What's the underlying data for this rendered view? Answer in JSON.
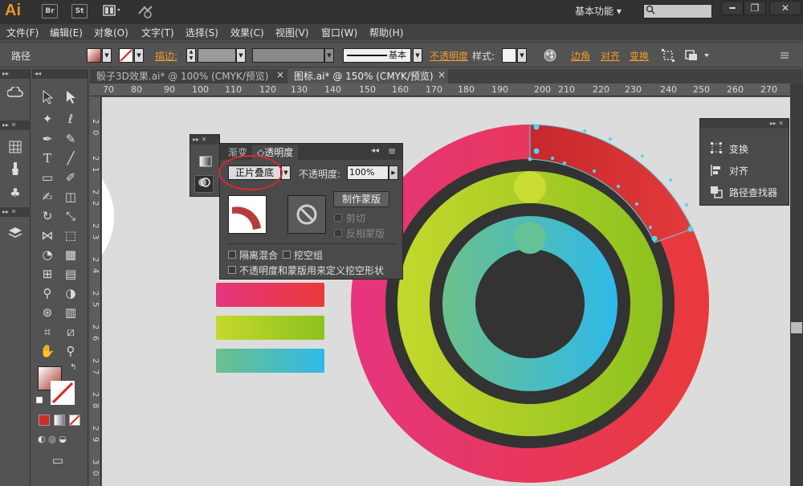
{
  "titlebar": {
    "app_logo": "Ai",
    "btn_br": "Br",
    "btn_st": "St",
    "workspace": "基本功能",
    "workspace_arrow": "▾",
    "win_min": "━",
    "win_max": "❐",
    "win_close": "✕"
  },
  "menu": [
    "文件(F)",
    "编辑(E)",
    "对象(O)",
    "文字(T)",
    "选择(S)",
    "效果(C)",
    "视图(V)",
    "窗口(W)",
    "帮助(H)"
  ],
  "controlbar": {
    "path_label": "路径",
    "stroke_label": "描边:",
    "stroke_style": "基本",
    "opacity_link": "不透明度",
    "style_label": "样式:",
    "corner_link": "边角",
    "align_link": "对齐",
    "transform_link": "变换"
  },
  "tabs": [
    {
      "label": "骰子3D效果.ai* @ 100% (CMYK/预览)",
      "close": "×"
    },
    {
      "label": "图标.ai* @ 150% (CMYK/预览)",
      "close": "×"
    }
  ],
  "ruler": {
    "h": [
      "70",
      "80",
      "90",
      "100",
      "110",
      "120",
      "130",
      "140",
      "150",
      "160",
      "170",
      "180",
      "190",
      "200",
      "210",
      "220",
      "230",
      "240",
      "250",
      "260",
      "270"
    ],
    "v": [
      "2",
      "0",
      "2",
      "1",
      "2",
      "2",
      "2",
      "3",
      "2",
      "4",
      "2",
      "5",
      "2",
      "6",
      "2",
      "7",
      "2",
      "8",
      "2",
      "9",
      "3",
      "0"
    ]
  },
  "transparency_panel": {
    "tab_gradient": "渐变",
    "tab_transparency": "◇透明度",
    "blend_mode": "正片叠底",
    "opacity_label": "不透明度:",
    "opacity_value": "100%",
    "make_mask": "制作蒙版",
    "clip": "剪切",
    "invert_mask": "反相蒙版",
    "isolate_blending": "隔离混合",
    "knockout_group": "挖空组",
    "opacity_mask_knockout": "不透明度和蒙版用来定义挖空形状"
  },
  "right_panel": {
    "transform": "变换",
    "align": "对齐",
    "pathfinder": "路径查找器"
  },
  "colors": {
    "ring_outer_start": "#e6357e",
    "ring_outer_end": "#e83a3a",
    "ring_middle_start": "#c4d82c",
    "ring_middle_end": "#8dc21f",
    "ring_inner_start": "#6cc08a",
    "ring_inner_end": "#2fb9ea",
    "dark": "#333333",
    "accent_orange": "#f09a2c"
  }
}
